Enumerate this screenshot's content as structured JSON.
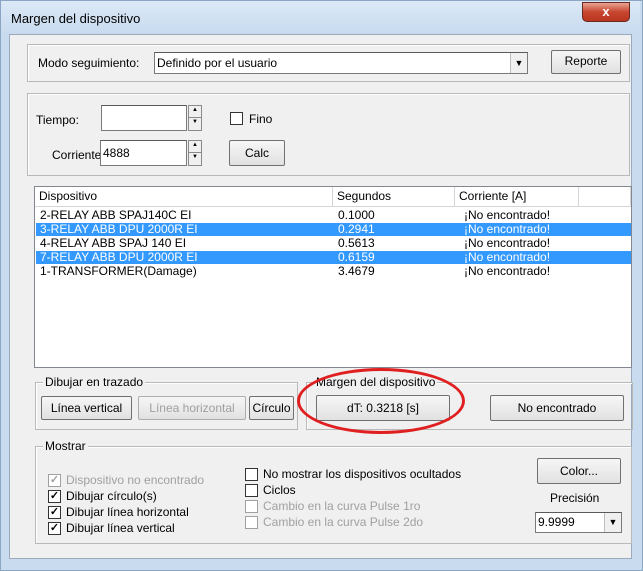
{
  "window": {
    "title": "Margen del dispositivo",
    "close_glyph": "x"
  },
  "mode": {
    "label": "Modo seguimiento:",
    "value": "Definido por el usuario",
    "report_label": "Reporte"
  },
  "tiempo": {
    "label": "Tiempo:",
    "value": "",
    "fino_label": "Fino"
  },
  "corriente": {
    "label": "Corriente:",
    "value": "4888",
    "calc_label": "Calc"
  },
  "table": {
    "headers": [
      "Dispositivo",
      "Segundos",
      "Corriente [A]"
    ],
    "rows": [
      {
        "device": "2-RELAY ABB SPAJ140C EI",
        "seconds": "0.1000",
        "current": "¡No encontrado!",
        "selected": false
      },
      {
        "device": "3-RELAY ABB DPU 2000R EI",
        "seconds": "0.2941",
        "current": "¡No encontrado!",
        "selected": true
      },
      {
        "device": "4-RELAY ABB SPAJ 140 EI",
        "seconds": "0.5613",
        "current": "¡No encontrado!",
        "selected": false
      },
      {
        "device": "7-RELAY ABB DPU 2000R EI",
        "seconds": "0.6159",
        "current": "¡No encontrado!",
        "selected": true
      },
      {
        "device": "1-TRANSFORMER(Damage)",
        "seconds": "3.4679",
        "current": "¡No encontrado!",
        "selected": false
      }
    ]
  },
  "dibujar": {
    "title": "Dibujar en trazado",
    "vertical": "Línea vertical",
    "horizontal": "Línea horizontal",
    "circulo": "Círculo"
  },
  "margen": {
    "title": "Margen del dispositivo",
    "dt": "dT: 0.3218 [s]",
    "status": "No encontrado"
  },
  "mostrar": {
    "title": "Mostrar",
    "left": [
      {
        "label": "Dispositivo no encontrado",
        "checked": true,
        "disabled": true
      },
      {
        "label": "Dibujar círculo(s)",
        "checked": true,
        "disabled": false
      },
      {
        "label": "Dibujar línea horizontal",
        "checked": true,
        "disabled": false
      },
      {
        "label": "Dibujar línea vertical",
        "checked": true,
        "disabled": false
      }
    ],
    "right": [
      {
        "label": "No mostrar los dispositivos ocultados",
        "checked": false,
        "disabled": false
      },
      {
        "label": "Ciclos",
        "checked": false,
        "disabled": false
      },
      {
        "label": "Cambio en la curva Pulse 1ro",
        "checked": false,
        "disabled": true
      },
      {
        "label": "Cambio en la curva Pulse 2do",
        "checked": false,
        "disabled": true
      }
    ],
    "color_label": "Color...",
    "precision_label": "Precisión",
    "precision_value": "9.9999"
  },
  "colors": {
    "selection": "#3399ff",
    "annotation": "#e02020"
  }
}
